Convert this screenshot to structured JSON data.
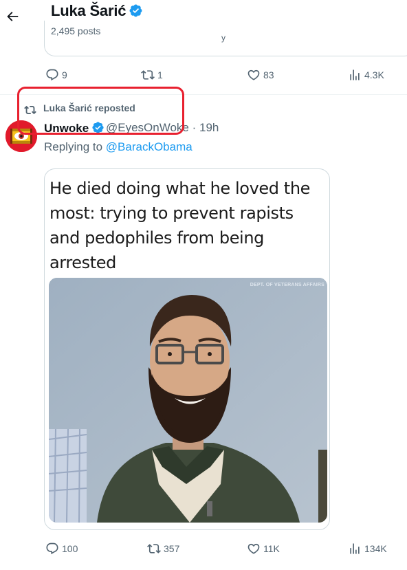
{
  "header": {
    "name": "Luka Šarić",
    "posts_count": "2,495 posts"
  },
  "previous_post": {
    "card_text_fragment": "y",
    "actions": {
      "replies": "9",
      "reposts": "1",
      "likes": "83",
      "views": "4.3K"
    }
  },
  "post": {
    "repost_label": "Luka Šarić reposted",
    "author": {
      "display_name": "Unwoke",
      "handle_time": "@EyesOnWoke · 19h"
    },
    "replying_to_prefix": "Replying to ",
    "replying_to_handle": "@BarackObama",
    "meme_text": "He died doing what he loved the most: trying to prevent rapists and pedophiles from being arrested",
    "photo_credit": "DEPT. OF VETERANS AFFAIRS",
    "actions": {
      "replies": "100",
      "reposts": "357",
      "likes": "11K",
      "views": "134K"
    }
  },
  "colors": {
    "accent": "#1d9bf0",
    "muted_text": "#536471",
    "annotation_red": "#e8202f",
    "avatar_red": "#e11a2b"
  },
  "icons": [
    "back-arrow-icon",
    "verified-badge-icon",
    "reply-icon",
    "repost-icon",
    "like-icon",
    "views-icon",
    "eye-logo-icon"
  ]
}
